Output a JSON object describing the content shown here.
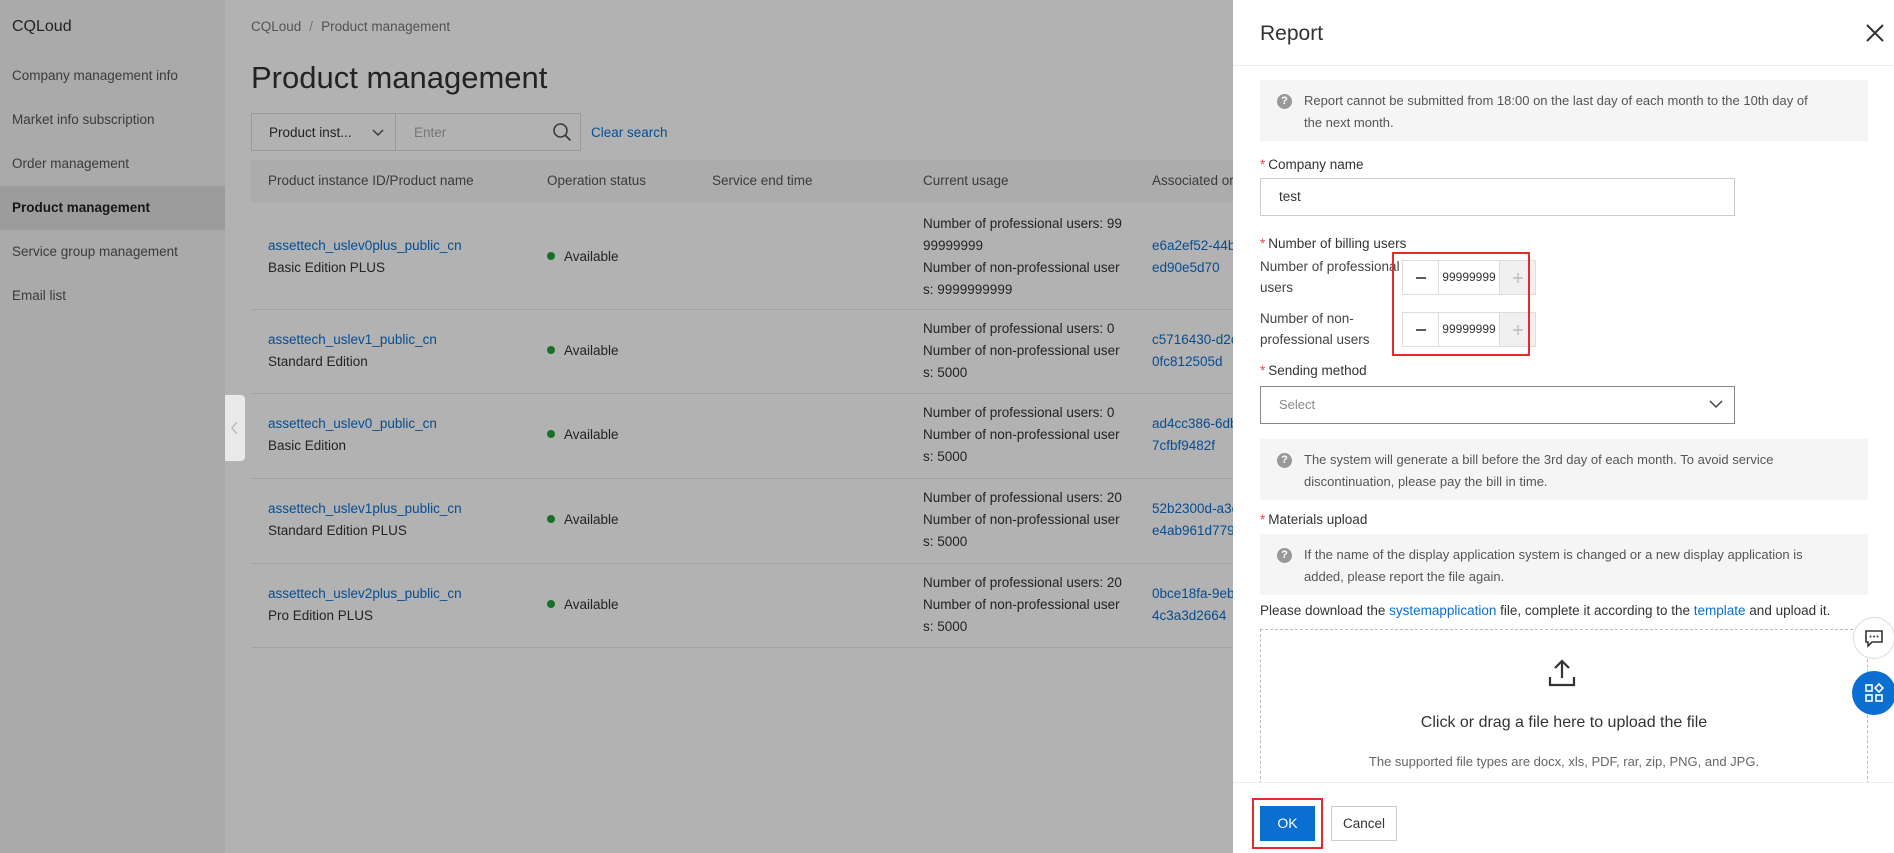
{
  "sidebar": {
    "brand": "CQLoud",
    "items": [
      {
        "label": "Company management info"
      },
      {
        "label": "Market info subscription"
      },
      {
        "label": "Order management"
      },
      {
        "label": "Product management"
      },
      {
        "label": "Service group management"
      },
      {
        "label": "Email list"
      }
    ]
  },
  "breadcrumb": {
    "root": "CQLoud",
    "separator": "/",
    "current": "Product management"
  },
  "page": {
    "title": "Product management"
  },
  "filter": {
    "select_label": "Product inst...",
    "input_placeholder": "Enter",
    "clear_label": "Clear search"
  },
  "table": {
    "columns": [
      "Product instance ID/Product name",
      "Operation status",
      "Service end time",
      "Current usage",
      "Associated or"
    ],
    "rows": [
      {
        "id": "assettech_uslev0plus_public_cn",
        "name": "Basic Edition PLUS",
        "status": "Available",
        "end_time": "",
        "usage_1": "Number of professional users: 99",
        "usage_2": "99999999",
        "usage_3": "Number of non-professional user",
        "usage_4": "s: 9999999999",
        "assoc_1": "e6a2ef52-44b",
        "assoc_2": "ed90e5d70"
      },
      {
        "id": "assettech_uslev1_public_cn",
        "name": "Standard Edition",
        "status": "Available",
        "end_time": "",
        "usage_1": "Number of professional users: 0",
        "usage_2": "Number of non-professional user",
        "usage_3": "s: 5000",
        "assoc_1": "c5716430-d2c",
        "assoc_2": "0fc812505d"
      },
      {
        "id": "assettech_uslev0_public_cn",
        "name": "Basic Edition",
        "status": "Available",
        "end_time": "",
        "usage_1": "Number of professional users: 0",
        "usage_2": "Number of non-professional user",
        "usage_3": "s: 5000",
        "assoc_1": "ad4cc386-6db",
        "assoc_2": "7cfbf9482f"
      },
      {
        "id": "assettech_uslev1plus_public_cn",
        "name": "Standard Edition PLUS",
        "status": "Available",
        "end_time": "",
        "usage_1": "Number of professional users: 20",
        "usage_2": "Number of non-professional user",
        "usage_3": "s: 5000",
        "assoc_1": "52b2300d-a3c",
        "assoc_2": "e4ab961d779"
      },
      {
        "id": "assettech_uslev2plus_public_cn",
        "name": "Pro Edition PLUS",
        "status": "Available",
        "end_time": "",
        "usage_1": "Number of professional users: 20",
        "usage_2": "Number of non-professional user",
        "usage_3": "s: 5000",
        "assoc_1": "0bce18fa-9eb",
        "assoc_2": "4c3a3d2664"
      }
    ]
  },
  "drawer": {
    "title": "Report",
    "notice_1_line1": "Report cannot be submitted from 18:00 on the last day of each month to the 10th day of",
    "notice_1_line2": "the next month.",
    "company_label": "Company name",
    "company_value": "test",
    "billing_label": "Number of billing users",
    "pro_label_1": "Number of professional",
    "pro_label_2": "users",
    "pro_value": "99999999",
    "nonpro_label_1": "Number of non-",
    "nonpro_label_2": "professional users",
    "nonpro_value": "99999999",
    "sending_label": "Sending method",
    "sending_placeholder": "Select",
    "notice_2_line1": "The system will generate a bill before the 3rd day of each month. To avoid service",
    "notice_2_line2": "discontinuation, please pay the bill in time.",
    "materials_label": "Materials upload",
    "notice_3_line1": "If the name of the display application system is changed or a new display application is",
    "notice_3_line2": "added, please report the file again.",
    "download_prefix": "Please download the ",
    "download_link": "systemapplication",
    "download_middle": " file, complete it according to the ",
    "template_link": "template",
    "download_suffix": " and upload it.",
    "upload_title": "Click or drag a file here to upload the file",
    "upload_sub": "The supported file types are docx, xls, PDF, rar, zip, PNG, and JPG.",
    "ok_label": "OK",
    "cancel_label": "Cancel"
  },
  "icons": {
    "close": "close-icon",
    "upload": "upload-icon",
    "chat": "chat-icon",
    "apps": "apps-icon",
    "help": "question-icon"
  },
  "colors": {
    "primary": "#0b6fd1",
    "required": "#e64b4b",
    "available": "#1fa33a",
    "highlight": "#e22b2b"
  }
}
